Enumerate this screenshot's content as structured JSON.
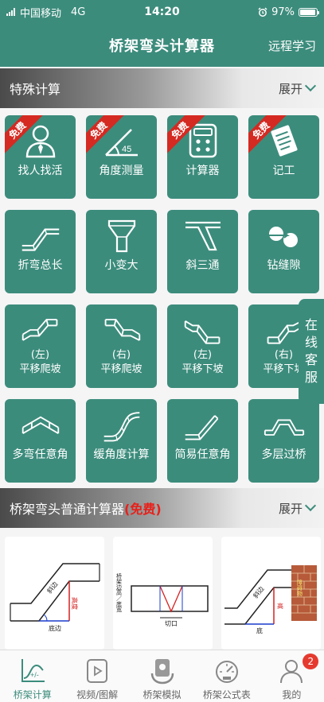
{
  "status_bar": {
    "carrier": "中国移动",
    "network": "4G",
    "time": "14:20",
    "battery": "97%",
    "battery_level": 0.97
  },
  "nav": {
    "title": "桥架弯头计算器",
    "right": "远程学习"
  },
  "special_section": {
    "title": "特殊计算",
    "expand": "展开"
  },
  "free_ribbon": "免费",
  "tiles": [
    {
      "label": "找人找活",
      "free": true,
      "icon": "person-tie-icon"
    },
    {
      "label": "角度测量",
      "free": true,
      "icon": "angle-icon",
      "angle_text": "45"
    },
    {
      "label": "计算器",
      "free": true,
      "icon": "calculator-icon"
    },
    {
      "label": "记工",
      "free": true,
      "icon": "notepad-icon"
    },
    {
      "label": "折弯总长",
      "icon": "bend-length-icon"
    },
    {
      "label": "小变大",
      "icon": "reducer-icon"
    },
    {
      "label": "斜三通",
      "icon": "oblique-tee-icon"
    },
    {
      "label": "钻缝隙",
      "icon": "gap-icon"
    },
    {
      "label": "(左)",
      "label2": "平移爬坡",
      "icon": "shift-climb-left-icon"
    },
    {
      "label": "(右)",
      "label2": "平移爬坡",
      "icon": "shift-climb-right-icon"
    },
    {
      "label": "(左)",
      "label2": "平移下坡",
      "icon": "shift-down-left-icon"
    },
    {
      "label": "(右)",
      "label2": "平移下坡",
      "icon": "shift-down-right-icon"
    },
    {
      "label": "多弯任意角",
      "icon": "multi-bend-icon"
    },
    {
      "label": "缓角度计算",
      "icon": "gentle-angle-icon"
    },
    {
      "label": "简易任意角",
      "icon": "simple-angle-icon"
    },
    {
      "label": "多层过桥",
      "icon": "multi-bridge-icon"
    }
  ],
  "customer_service": "在线客服",
  "normal_section": {
    "title": "桥架弯头普通计算器",
    "free": "(免费)",
    "expand": "展开"
  },
  "cards": [
    {
      "diagram_labels": [
        "斜边",
        "高度",
        "底边"
      ]
    },
    {
      "diagram_labels": [
        "桥架边高／底宽",
        "切口"
      ]
    },
    {
      "diagram_labels": [
        "斜边",
        "高",
        "底",
        "障碍物"
      ]
    }
  ],
  "tabs": [
    {
      "label": "桥架计算",
      "icon": "chart-icon",
      "active": true
    },
    {
      "label": "视频/图解",
      "icon": "video-icon"
    },
    {
      "label": "桥架模拟",
      "icon": "hand-device-icon"
    },
    {
      "label": "桥架公式表",
      "icon": "gauge-icon"
    },
    {
      "label": "我的",
      "icon": "user-icon",
      "badge": "2"
    }
  ],
  "colors": {
    "primary": "#3c8c7c",
    "ribbon": "#d42a22",
    "badge": "#e53a2f"
  }
}
